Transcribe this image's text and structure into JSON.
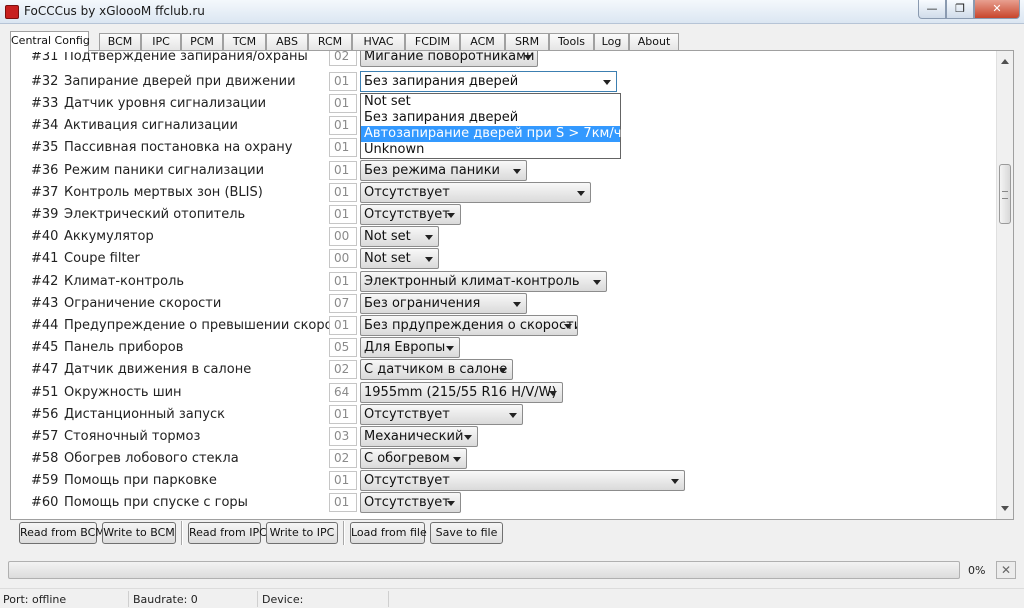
{
  "window": {
    "title": "FoCCCus by xGloooM ffclub.ru",
    "minimize_glyph": "—",
    "maximize_glyph": "❐",
    "close_glyph": "✕"
  },
  "tabs": [
    "Central Config",
    "BCM",
    "IPC",
    "PCM",
    "TCM",
    "ABS",
    "RCM",
    "HVAC",
    "FCDIM",
    "ACM",
    "SRM",
    "Tools",
    "Log",
    "About"
  ],
  "active_tab": "Central Config",
  "rows": [
    {
      "num": "#31",
      "label": "Подтверждение запирания/охраны",
      "value": "02",
      "selected": "Мигание поворотниками"
    },
    {
      "num": "#32",
      "label": "Запирание дверей при движении",
      "value": "01",
      "selected": "Без запирания дверей"
    },
    {
      "num": "#33",
      "label": "Датчик уровня сигнализации",
      "value": "01",
      "selected": ""
    },
    {
      "num": "#34",
      "label": "Активация сигнализации",
      "value": "01",
      "selected": ""
    },
    {
      "num": "#35",
      "label": "Пассивная постановка на охрану",
      "value": "01",
      "selected": ""
    },
    {
      "num": "#36",
      "label": "Режим паники сигнализации",
      "value": "01",
      "selected": "Без режима паники"
    },
    {
      "num": "#37",
      "label": "Контроль мертвых зон (BLIS)",
      "value": "01",
      "selected": "Отсутствует"
    },
    {
      "num": "#39",
      "label": "Электрический отопитель",
      "value": "01",
      "selected": "Отсутствует"
    },
    {
      "num": "#40",
      "label": "Аккумулятор",
      "value": "00",
      "selected": "Not set"
    },
    {
      "num": "#41",
      "label": "Coupe filter",
      "value": "00",
      "selected": "Not set"
    },
    {
      "num": "#42",
      "label": "Климат-контроль",
      "value": "01",
      "selected": "Электронный климат-контроль"
    },
    {
      "num": "#43",
      "label": "Ограничение скорости",
      "value": "07",
      "selected": "Без ограничения"
    },
    {
      "num": "#44",
      "label": "Предупреждение о превышении скорости",
      "value": "01",
      "selected": "Без прдупреждения о скорости"
    },
    {
      "num": "#45",
      "label": "Панель приборов",
      "value": "05",
      "selected": "Для Европы"
    },
    {
      "num": "#47",
      "label": "Датчик движения в салоне",
      "value": "02",
      "selected": "С датчиком в салоне"
    },
    {
      "num": "#51",
      "label": "Окружность шин",
      "value": "64",
      "selected": "1955mm (215/55 R16 H/V/W)"
    },
    {
      "num": "#56",
      "label": "Дистанционный запуск",
      "value": "01",
      "selected": "Отсутствует"
    },
    {
      "num": "#57",
      "label": "Стояночный тормоз",
      "value": "03",
      "selected": "Механический"
    },
    {
      "num": "#58",
      "label": "Обогрев лобового стекла",
      "value": "02",
      "selected": "С обогревом"
    },
    {
      "num": "#59",
      "label": "Помощь при парковке",
      "value": "01",
      "selected": "Отсутствует"
    },
    {
      "num": "#60",
      "label": "Помощь при спуске с горы",
      "value": "01",
      "selected": "Отсутствует"
    }
  ],
  "open_dropdown": {
    "row": "#32",
    "options": [
      "Not set",
      "Без запирания дверей",
      "Автозапирание дверей при S > 7км/ч",
      "Unknown"
    ],
    "highlighted": "Автозапирание дверей при S > 7км/ч"
  },
  "buttons": {
    "read_bcm": "Read from BCM",
    "write_bcm": "Write to BCM",
    "read_ipc": "Read from IPC",
    "write_ipc": "Write to IPC",
    "load_file": "Load from file",
    "save_file": "Save to file"
  },
  "progress": {
    "value": 0,
    "label": "0%",
    "cancel_glyph": "✕"
  },
  "status": {
    "port": "Port: offline",
    "baudrate": "Baudrate: 0",
    "device": "Device:"
  },
  "colors": {
    "selection": "#3399ff",
    "progress_fill": "#37b24d"
  }
}
